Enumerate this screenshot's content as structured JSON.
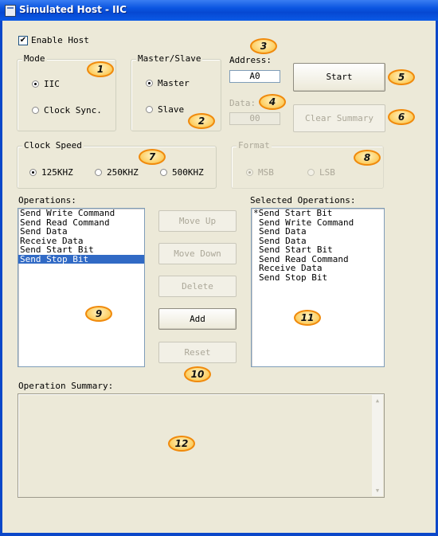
{
  "window": {
    "title": "Simulated Host - IIC"
  },
  "enable_host": {
    "label": "Enable Host",
    "checked": true,
    "check_mark": "✔"
  },
  "mode": {
    "title": "Mode",
    "options": [
      "IIC",
      "Clock Sync."
    ],
    "selected": "IIC"
  },
  "master_slave": {
    "title": "Master/Slave",
    "options": [
      "Master",
      "Slave"
    ],
    "selected": "Master"
  },
  "address": {
    "label": "Address:",
    "value": "A0"
  },
  "data": {
    "label": "Data:",
    "value": "00"
  },
  "buttons": {
    "start": "Start",
    "clear_summary": "Clear Summary",
    "move_up": "Move Up",
    "move_down": "Move Down",
    "delete": "Delete",
    "add": "Add",
    "reset": "Reset"
  },
  "clock_speed": {
    "title": "Clock Speed",
    "options": [
      "125KHZ",
      "250KHZ",
      "500KHZ"
    ],
    "selected": "125KHZ"
  },
  "format": {
    "title": "Format",
    "options": [
      "MSB",
      "LSB"
    ],
    "selected": "MSB"
  },
  "operations": {
    "label": "Operations:",
    "items": [
      "Send Write Command",
      "Send Read Command",
      "Send Data",
      "Receive Data",
      "Send Start Bit",
      "Send Stop Bit"
    ],
    "selected_index": 5
  },
  "selected_operations": {
    "label": "Selected Operations:",
    "items": [
      "*Send Start Bit",
      "Send Write Command",
      "Send Data",
      "Send Data",
      "Send Start Bit",
      "Send Read Command",
      "Receive Data",
      "Send Stop Bit"
    ]
  },
  "operation_summary": {
    "label": "Operation Summary:"
  },
  "callouts": [
    "1",
    "2",
    "3",
    "4",
    "5",
    "6",
    "7",
    "8",
    "9",
    "10",
    "11",
    "12"
  ],
  "scroll_arrows": {
    "up": "▲",
    "down": "▼"
  },
  "colors": {
    "title_bar": "#0a55e0",
    "face": "#ece9d8",
    "selection": "#316ac5",
    "callout_border": "#f08a0c",
    "callout_fill": "#fdd36e"
  }
}
